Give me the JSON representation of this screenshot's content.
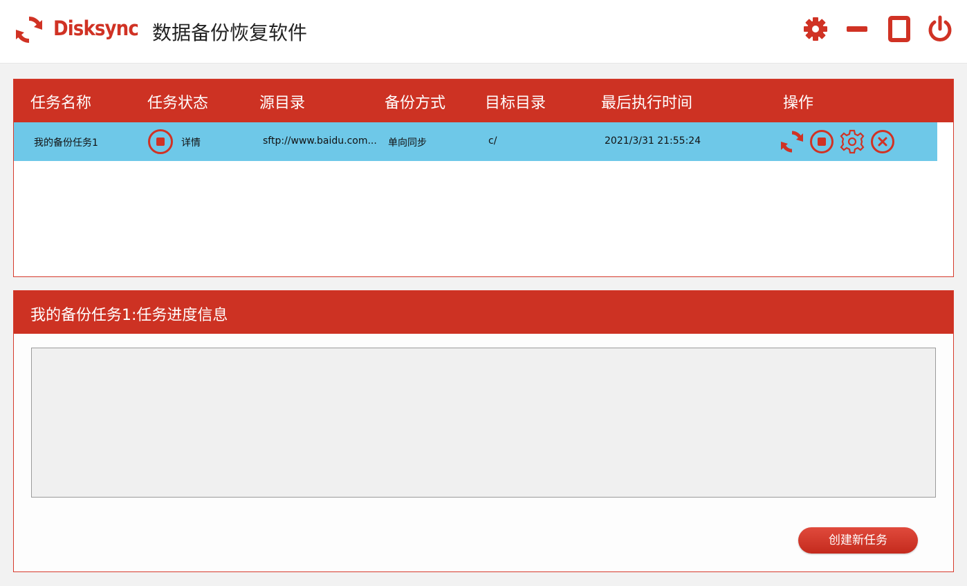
{
  "app": {
    "brand": "Disksync",
    "title": "数据备份恢复软件",
    "accent_color": "#cd3223",
    "icons": {
      "logo": "sync-arrows-icon",
      "settings": "gear-icon",
      "minimize": "minimize-icon",
      "maximize": "maximize-icon",
      "close": "power-icon"
    }
  },
  "table": {
    "headers": [
      "任务名称",
      "任务状态",
      "源目录",
      "备份方式",
      "目标目录",
      "最后执行时间",
      "操作"
    ],
    "rows": [
      {
        "name": "我的备份任务1",
        "status_label": "详情",
        "source": "sftp://www.baidu.com...",
        "method": "单向同步",
        "target": "c/",
        "last_run": "2021/3/31 21:55:24",
        "actions": [
          "sync-icon",
          "stop-icon",
          "settings-icon",
          "delete-icon"
        ]
      }
    ],
    "row_highlight_color": "#6ec8e8"
  },
  "progress": {
    "title": "我的备份任务1:任务进度信息"
  },
  "buttons": {
    "create_task": "创建新任务"
  }
}
